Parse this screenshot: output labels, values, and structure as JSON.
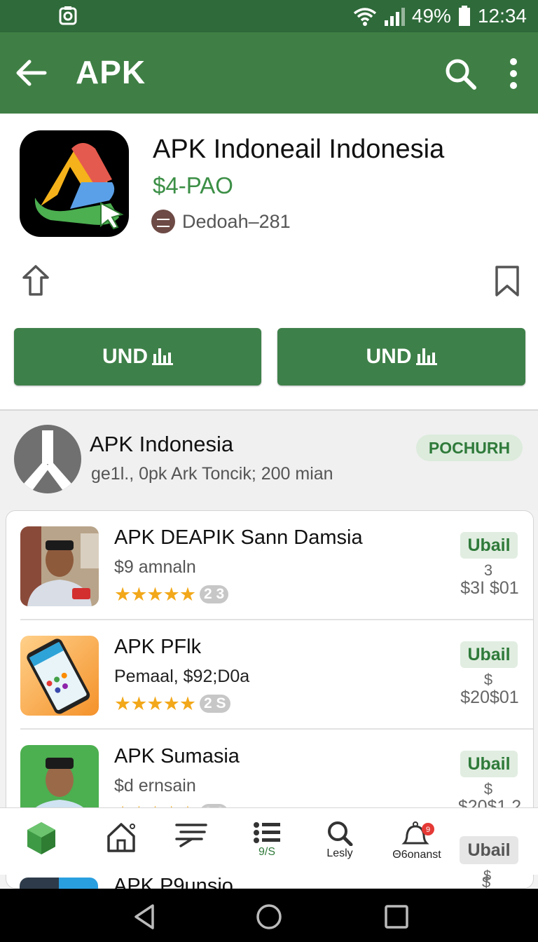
{
  "status_bar": {
    "battery": "49%",
    "time": "12:34",
    "icons": [
      "screenshot-icon",
      "wifi-icon",
      "signal-icon",
      "battery-icon"
    ]
  },
  "app_bar": {
    "title": "APK",
    "icons": [
      "back-arrow-icon",
      "search-icon",
      "more-vert-icon"
    ],
    "color": "#3f7f45"
  },
  "app": {
    "name": "APK Indoneail Indonesia",
    "price": "$4-PAO",
    "developer": "Dedoah–281",
    "icons": [
      "share-icon",
      "bookmark-icon"
    ]
  },
  "buttons": [
    {
      "label": "UND"
    },
    {
      "label": "UND"
    }
  ],
  "developer_section": {
    "title": "APK Indonesia",
    "subtitle": "ge1l., 0pk Ark  Toncik; 200 mian",
    "badge": "POCHURH"
  },
  "list": [
    {
      "title": "APK DEAPIK Sann Damsia",
      "subtitle": "$9 amnaln",
      "stars": "★★★★★",
      "count": "2 3",
      "action": "Ubail",
      "price_top": "3",
      "price": "$3I $01"
    },
    {
      "title": "APK PFlk",
      "subtitle": "Pemaal, $92;D0a",
      "stars": "★★★★★",
      "count": "2 S",
      "action": "Ubail",
      "price_top": "$",
      "price": "$20$01"
    },
    {
      "title": "APK Sumasia",
      "subtitle": "$d ernsain",
      "stars": "★★★★★",
      "count": "2 3",
      "action": "Ubail",
      "price_top": "$",
      "price": "$20$1.2"
    }
  ],
  "peek_item": {
    "title": "APK P9unsio",
    "price": "$"
  },
  "bottom_nav": {
    "items": [
      {
        "label": "",
        "icon": "app-cube-icon"
      },
      {
        "label": "",
        "icon": "home-icon"
      },
      {
        "label": "",
        "icon": "list-lines-icon"
      },
      {
        "label": "9/S",
        "icon": "list-icon"
      },
      {
        "label": "Lesly",
        "icon": "search-icon"
      },
      {
        "label": "Θ6onanst",
        "icon": "notification-icon"
      }
    ],
    "action": "Ubail",
    "price": "$"
  },
  "system_nav": [
    "back-triangle-icon",
    "home-circle-icon",
    "recents-square-icon"
  ],
  "colors": {
    "brand_green": "#3e8049",
    "status_green": "#2f6a3a",
    "price_green": "#3c8f46",
    "star": "#f2a81a"
  }
}
